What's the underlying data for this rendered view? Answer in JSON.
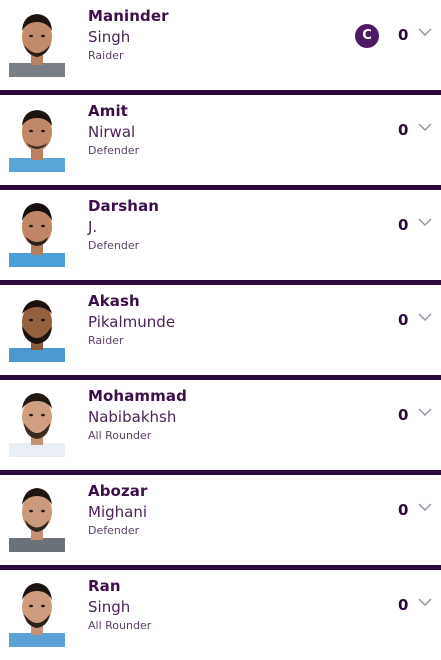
{
  "colors": {
    "divider": "#2a0a3b",
    "text_primary": "#3b0f4a",
    "captain_badge": "#4d1a63",
    "chevron": "#9a8ca0"
  },
  "players": [
    {
      "first": "Maninder",
      "last": "Singh",
      "role": "Raider",
      "points": "0",
      "captain": "C"
    },
    {
      "first": "Amit",
      "last": "Nirwal",
      "role": "Defender",
      "points": "0"
    },
    {
      "first": "Darshan",
      "last": "J.",
      "role": "Defender",
      "points": "0"
    },
    {
      "first": "Akash",
      "last": "Pikalmunde",
      "role": "Raider",
      "points": "0"
    },
    {
      "first": "Mohammad",
      "last": "Nabibakhsh",
      "role": "All Rounder",
      "points": "0"
    },
    {
      "first": "Abozar",
      "last": "Mighani",
      "role": "Defender",
      "points": "0"
    },
    {
      "first": "Ran",
      "last": "Singh",
      "role": "All Rounder",
      "points": "0"
    }
  ],
  "icons": {
    "expand": "chevron-down-icon",
    "captain": "captain-badge",
    "photo": "player-photo"
  }
}
